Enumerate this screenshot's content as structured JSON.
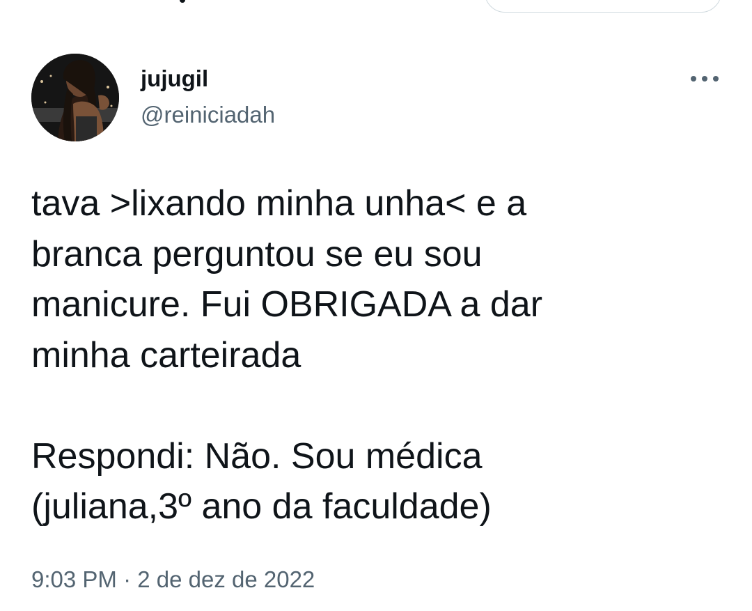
{
  "tweet": {
    "author": {
      "display_name": "jujugil",
      "handle": "@reiniciadah"
    },
    "body_lines": [
      "tava >lixando minha unha< e a",
      "branca perguntou se eu sou",
      "manicure. Fui OBRIGADA a dar",
      "minha carteirada",
      "Respondi: Não. Sou médica",
      "(juliana,3º ano da faculdade)"
    ],
    "timestamp": "9:03 PM · 2 de dez de 2022",
    "more_icon": "more-horizontal-icon"
  },
  "colors": {
    "text_primary": "#0f1419",
    "text_secondary": "#536471",
    "border": "#cfd9de"
  }
}
